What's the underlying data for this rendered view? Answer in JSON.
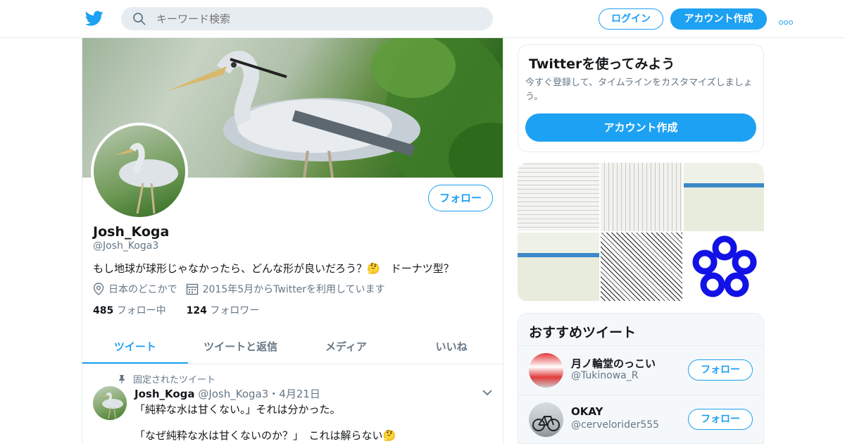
{
  "topbar": {
    "search_placeholder": "キーワード検索",
    "login_label": "ログイン",
    "signup_label": "アカウント作成"
  },
  "profile": {
    "display_name": "Josh_Koga",
    "handle": "@Josh_Koga3",
    "bio": "もし地球が球形じゃなかったら、どんな形が良いだろう？🤔　ドーナツ型？",
    "location": "日本のどこかで",
    "joined": "2015年5月からTwitterを利用しています",
    "following_count": "485",
    "following_label": "フォロー中",
    "followers_count": "124",
    "followers_label": "フォロワー",
    "follow_label": "フォロー"
  },
  "tabs": [
    {
      "label": "ツイート",
      "active": true
    },
    {
      "label": "ツイートと返信",
      "active": false
    },
    {
      "label": "メディア",
      "active": false
    },
    {
      "label": "いいね",
      "active": false
    }
  ],
  "pinned_tweet": {
    "pinned_label": "固定されたツイート",
    "name": "Josh_Koga",
    "handle": "@Josh_Koga3",
    "separator": "・",
    "date": "4月21日",
    "line1": "「純粋な水は甘くない。」それは分かった。",
    "line2": "「なぜ純粋な水は甘くないのか？」　これは解らない🤔"
  },
  "signup_card": {
    "title": "Twitterを使ってみよう",
    "subtitle": "今すぐ登録して、タイムラインをカスタマイズしましょう。",
    "button_label": "アカウント作成"
  },
  "recommended": {
    "title": "おすすめツイート",
    "accounts": [
      {
        "name": "月ノ輪堂のっこい",
        "handle": "@Tukinowa_R",
        "follow_label": "フォロー"
      },
      {
        "name": "OKAY",
        "handle": "@cervelorider555",
        "follow_label": "フォロー"
      }
    ]
  },
  "colors": {
    "accent": "#1da1f2",
    "secondary_text": "#657786",
    "border": "#e6ecf0"
  }
}
